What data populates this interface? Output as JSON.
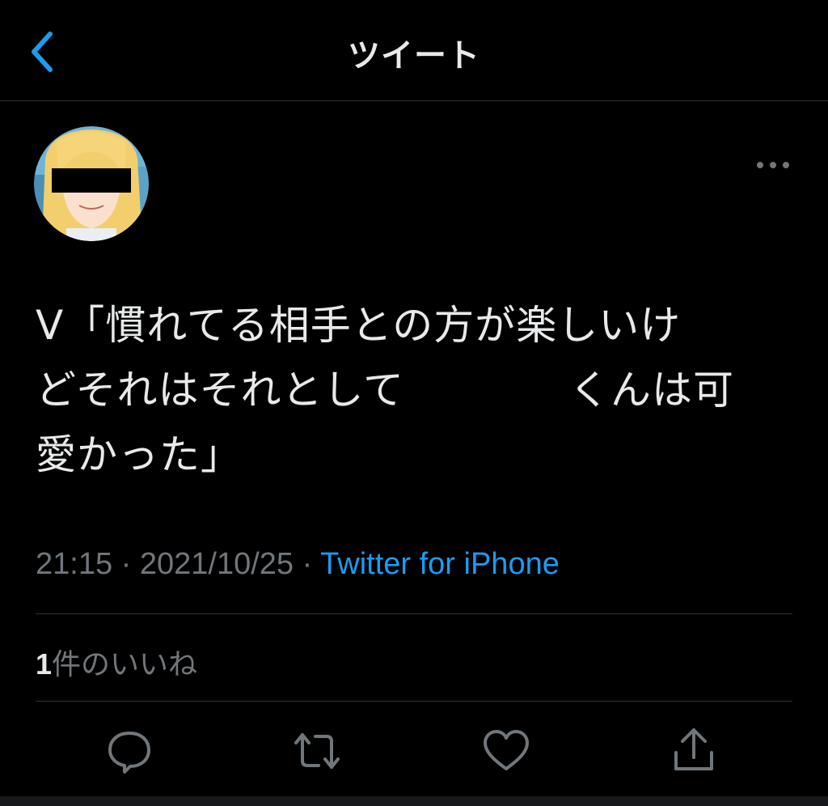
{
  "nav": {
    "title": "ツイート"
  },
  "tweet": {
    "text": "V「慣れてる相手との方が楽しいけどそれはそれとして　　　　くんは可愛かった」",
    "line1": "V「慣れてる相手との方が楽しいけ",
    "line2": "どそれはそれとして　　　　くんは可",
    "line3": "愛かった」",
    "time": "21:15",
    "separator": " · ",
    "date": "2021/10/25",
    "source": "Twitter for iPhone"
  },
  "likes": {
    "count": "1",
    "label": "件のいいね"
  },
  "actions": [
    "reply-icon",
    "retweet-icon",
    "like-icon",
    "share-icon"
  ],
  "colors": {
    "background": "#000000",
    "text": "#e7e9ea",
    "secondary": "#71767b",
    "accent": "#1d9bf0",
    "divider": "#2f3336"
  }
}
